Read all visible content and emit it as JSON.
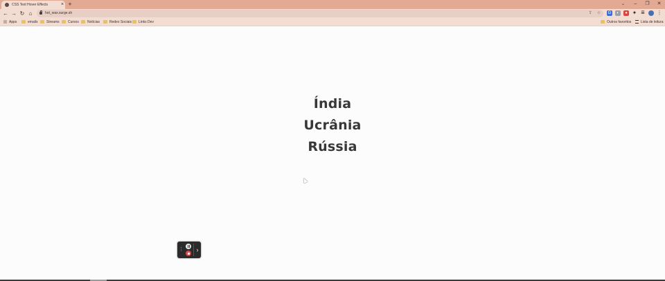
{
  "browser": {
    "tab": {
      "title": "CSS Text Hover Effects",
      "close_glyph": "×"
    },
    "new_tab_glyph": "+",
    "tab_search_glyph": "⌄",
    "window_controls": {
      "minimize": "–",
      "maximize": "❐",
      "close": "✕"
    },
    "nav": {
      "back": "←",
      "forward": "→",
      "reload": "↻",
      "home": "⌂"
    },
    "address": {
      "url": "hot_wax.surge.sh"
    },
    "menu_glyph": "⋮"
  },
  "bookmarks": {
    "apps": "Apps",
    "items": [
      "emails",
      "Streams",
      "Cursos",
      "Notícias",
      "Redes Sociais",
      "Links Dev"
    ],
    "other": "Outros favoritos",
    "reading_list": "Lista de leitura"
  },
  "page": {
    "menu": [
      "Índia",
      "Ucrânia",
      "Rússia"
    ]
  },
  "recorder": {
    "drag_glyph": "⋮",
    "expand_glyph": "›"
  },
  "colors": {
    "tabstrip": "#e2a993",
    "toolbar": "#f3ddd3",
    "text": "#383838",
    "background": "#fcfcfc"
  }
}
